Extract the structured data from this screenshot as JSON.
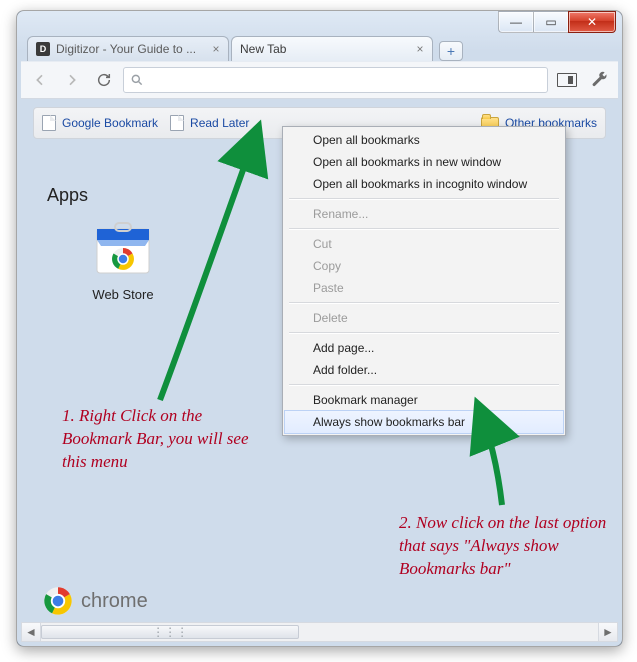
{
  "window": {
    "minimize_glyph": "—",
    "maximize_glyph": "▭",
    "close_glyph": "✕"
  },
  "tabs": {
    "0": {
      "label": "Digitizor - Your Guide to ..."
    },
    "1": {
      "label": "New Tab"
    },
    "close_glyph": "×",
    "newtab_glyph": "+"
  },
  "toolbar": {
    "omnibox_value": "",
    "omnibox_placeholder": ""
  },
  "bookmarks": {
    "0": {
      "label": "Google Bookmark"
    },
    "1": {
      "label": "Read Later"
    },
    "other": {
      "label": "Other bookmarks"
    }
  },
  "content": {
    "apps_heading": "Apps",
    "webstore_label": "Web Store"
  },
  "branding": {
    "label": "chrome"
  },
  "hscroll_grip": "⋮⋮⋮",
  "context_menu": {
    "0": "Open all bookmarks",
    "1": "Open all bookmarks in new window",
    "2": "Open all bookmarks in incognito window",
    "3": "Rename...",
    "4": "Cut",
    "5": "Copy",
    "6": "Paste",
    "7": "Delete",
    "8": "Add page...",
    "9": "Add folder...",
    "10": "Bookmark manager",
    "11": "Always show bookmarks bar"
  },
  "annotations": {
    "a1": "1. Right Click on the Bookmark Bar, you will see this menu",
    "a2": "2. Now click on the last option that says \"Always show Bookmarks bar\""
  }
}
